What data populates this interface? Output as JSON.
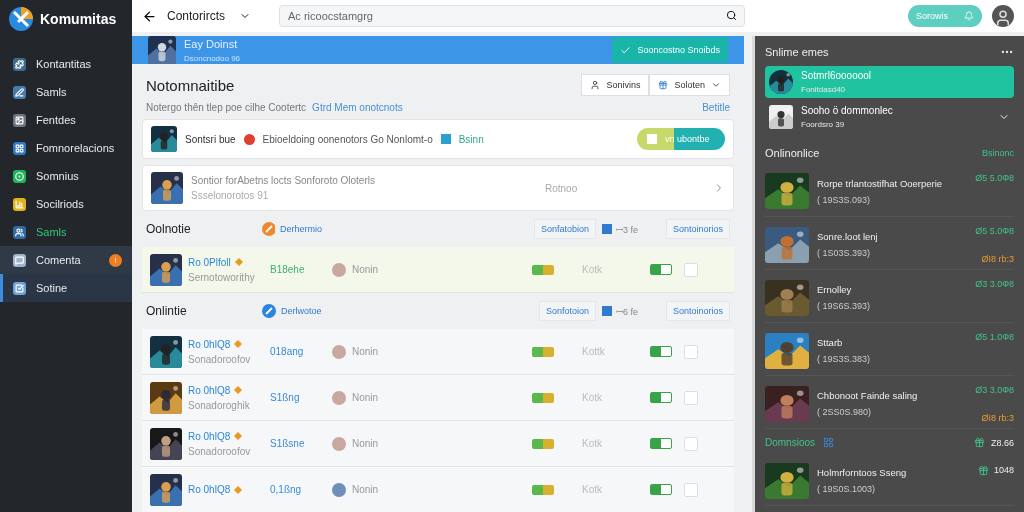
{
  "sidebar": {
    "logo": "Komumitas",
    "items": [
      {
        "label": "Kontantitas",
        "color": "#3d6a8f",
        "selected": false,
        "hovered": false,
        "highlighted": false
      },
      {
        "label": "Samls",
        "color": "#4a7aa8",
        "selected": false,
        "hovered": false,
        "highlighted": false
      },
      {
        "label": "Fentdes",
        "color": "#6b7480",
        "selected": false,
        "hovered": false,
        "highlighted": false
      },
      {
        "label": "Fomnorelacions",
        "color": "#2f79c4",
        "selected": false,
        "hovered": false,
        "highlighted": false
      },
      {
        "label": "Somnius",
        "color": "#22b45a",
        "selected": false,
        "hovered": false,
        "highlighted": false
      },
      {
        "label": "Socilriods",
        "color": "#e0b21e",
        "selected": false,
        "hovered": false,
        "highlighted": false
      },
      {
        "label": "Samls",
        "color": "#2f6aa0",
        "selected": false,
        "hovered": false,
        "highlighted": true
      },
      {
        "label": "Comenta",
        "color": "#9fb4cc",
        "selected": false,
        "hovered": true,
        "highlighted": false,
        "badge": "!"
      },
      {
        "label": "Sotine",
        "color": "#6fa3d6",
        "selected": true,
        "hovered": false,
        "highlighted": false
      }
    ]
  },
  "topbar": {
    "title": "Contorircts",
    "search": {
      "placeholder": "Ac ricoocstamgrg"
    },
    "action": "Sorowis"
  },
  "banner": {
    "title": "Eay Doinst",
    "subtitle": "Dsoncnodoo 96",
    "button": "Sooncostno Snoibds"
  },
  "header": {
    "title": "Notomnaitibe",
    "buttons": [
      "Sonivins",
      "Soloten"
    ],
    "subtitle": "Notergo thên tlep poe cilhe Cootertc",
    "link": "Gtrd Mem onotcnots",
    "side_link": "Betitle"
  },
  "notice": {
    "name": "Sontsri bue",
    "text": "Ebioeldoing oonenotors Go Nonlomt-o",
    "tag": "Bsinn",
    "button": "vn ubontbe"
  },
  "promo": {
    "title": "Sontior forAbetns locts Sonforoto Oloterls",
    "subtitle": "Ssselonorotos 91",
    "status": "Rotnoo"
  },
  "sections": [
    {
      "title": "Oolnotie",
      "filter": "Derhermio",
      "color": "#f0892c",
      "columns": [
        "Sonfatobion",
        "ꟷ3 fe",
        "Sontoinorios"
      ],
      "rows": [
        {
          "title": "Ro 0Plfoll",
          "subtitle": "Sernotoworithy",
          "score": "B18ehe",
          "user": "Nonin",
          "state": "Kotk",
          "on": true,
          "checked": false,
          "selected": true
        }
      ]
    },
    {
      "title": "Onlintie",
      "filter": "Derlwotoe",
      "color": "#2a84e0",
      "columns": [
        "Sonfotoion",
        "ꟷ6 fe",
        "Sontoinorios"
      ],
      "rows": [
        {
          "title": "Ro 0hlQ8",
          "subtitle": "Sonadoroofov",
          "score": "018ang",
          "user": "Nonin",
          "state": "Kottk",
          "on": true,
          "checked": false,
          "selected": false
        },
        {
          "title": "Ro 0hlQ8",
          "subtitle": "Sonadoroghik",
          "score": "S1ßng",
          "user": "Nonin",
          "state": "Kotk",
          "on": true,
          "checked": false,
          "selected": false
        },
        {
          "title": "Ro 0hlQ8",
          "subtitle": "Sonadoroofov",
          "score": "S1ßsne",
          "user": "Nonin",
          "state": "Kotk",
          "on": true,
          "checked": false,
          "selected": false
        },
        {
          "title": "Ro 0hlQ8",
          "score": "0,1ßng",
          "user": "Nonin",
          "state": "Kotk",
          "on": true,
          "checked": false,
          "selected": false
        }
      ]
    }
  ],
  "panel": {
    "title": "Snlime emes",
    "accounts": [
      {
        "name": "Sotmrl6ooooool",
        "meta": "Fonitdasd40",
        "selected": true
      },
      {
        "name": "Sooho ö dommonlec",
        "meta": "Foordsro 39",
        "selected": false
      }
    ],
    "section": "Onlinonlice",
    "section_link": "Bsinonc",
    "games": [
      {
        "title": "Rorpe trlantostifhat Ooerperie",
        "meta": "( 19S3S.093)",
        "price": "Ø5 5.0Ф8"
      },
      {
        "title": "Sonre.loot lenj",
        "meta": "( 1S03S.393)",
        "price": "Ø5 5.0Ф8",
        "tag": "ØI8 rb:3"
      },
      {
        "title": "Ernolley",
        "meta": "( 19S6S.393)",
        "price": "Ø3 3.0Ф8"
      },
      {
        "title": "Sttarb",
        "meta": "( 19S3S.383)",
        "price": "Ø5 1.0Ф8"
      },
      {
        "title": "Chbonoot Fainde saling",
        "meta": "( 2SS0S.980)",
        "price": "Ø3 3.0Ф8",
        "tag": "ØI8 rb:3"
      }
    ],
    "footer": {
      "label": "Domnsioos",
      "value": "Z8.66"
    },
    "last": {
      "title": "Holmrforntoos Sseng",
      "meta": "( 19S0S.1003)",
      "price": "1048"
    }
  }
}
